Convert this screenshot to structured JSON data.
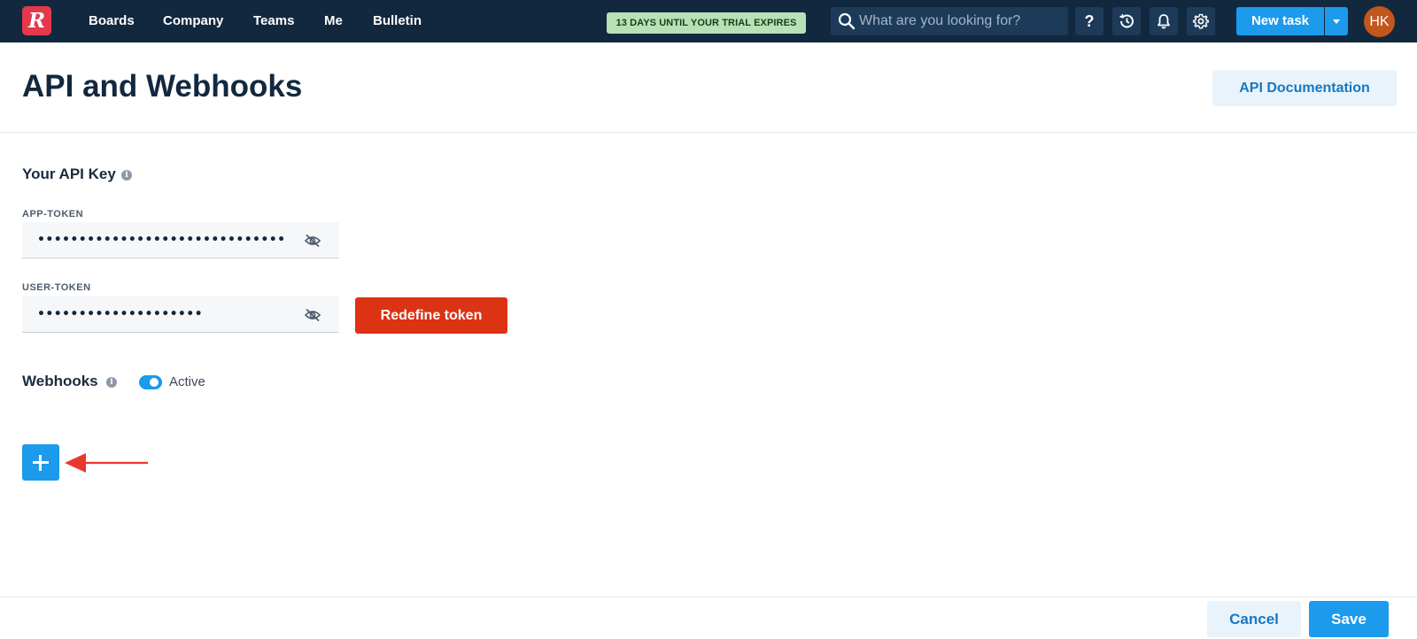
{
  "topbar": {
    "logo_letter": "R",
    "nav": [
      "Boards",
      "Company",
      "Teams",
      "Me",
      "Bulletin"
    ],
    "trial_badge": "13 DAYS UNTIL YOUR TRIAL EXPIRES",
    "search_placeholder": "What are you looking for?",
    "icons": [
      "help-icon",
      "history-icon",
      "bell-icon",
      "gear-icon"
    ],
    "help_glyph": "?",
    "new_task_label": "New task",
    "avatar_initials": "HK"
  },
  "page": {
    "title": "API and Webhooks",
    "api_doc_label": "API Documentation"
  },
  "api_key": {
    "section_title": "Your API Key",
    "app_token_label": "APP-TOKEN",
    "app_token_mask": "••••••••••••••••••••••••••••••",
    "user_token_label": "USER-TOKEN",
    "user_token_mask": "••••••••••••••••••••",
    "redefine_label": "Redefine token"
  },
  "webhooks": {
    "section_title": "Webhooks",
    "toggle_state": "on",
    "toggle_label": "Active"
  },
  "footer": {
    "cancel_label": "Cancel",
    "save_label": "Save"
  },
  "colors": {
    "topbar_bg": "#12283f",
    "primary_blue": "#1c9aeb",
    "danger_red": "#db3314",
    "trial_green": "#b6e2b6",
    "annotation_arrow": "#e8392c"
  }
}
